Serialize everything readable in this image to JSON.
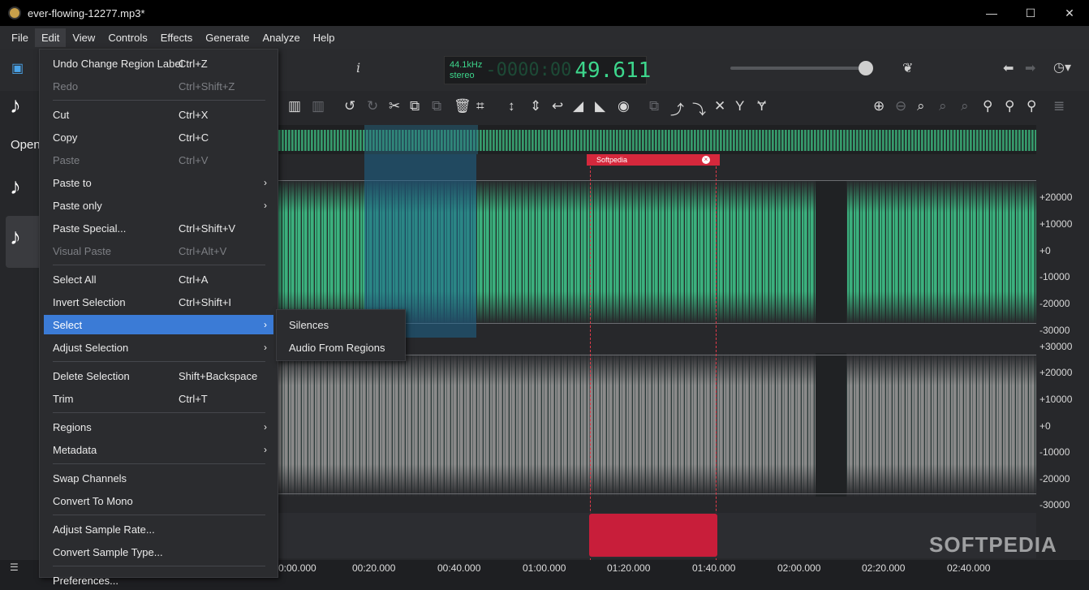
{
  "window": {
    "title": "ever-flowing-12277.mp3*",
    "controls": [
      "—",
      "☐",
      "✕"
    ]
  },
  "menubar": [
    "File",
    "Edit",
    "View",
    "Controls",
    "Effects",
    "Generate",
    "Analyze",
    "Help"
  ],
  "transport": {
    "sample_rate": "44.1kHz",
    "channels": "stereo",
    "dim_digits": "-0000:00",
    "position": "49.611"
  },
  "sidebar": {
    "open_label": "Open"
  },
  "edit_menu": {
    "items": [
      {
        "label": "Undo Change Region Label",
        "shortcut": "Ctrl+Z"
      },
      {
        "label": "Redo",
        "shortcut": "Ctrl+Shift+Z"
      },
      {
        "label": "Cut",
        "shortcut": "Ctrl+X"
      },
      {
        "label": "Copy",
        "shortcut": "Ctrl+C"
      },
      {
        "label": "Paste",
        "shortcut": "Ctrl+V"
      },
      {
        "label": "Paste to",
        "shortcut": ""
      },
      {
        "label": "Paste only",
        "shortcut": ""
      },
      {
        "label": "Paste Special...",
        "shortcut": "Ctrl+Shift+V"
      },
      {
        "label": "Visual Paste",
        "shortcut": "Ctrl+Alt+V"
      },
      {
        "label": "Select All",
        "shortcut": "Ctrl+A"
      },
      {
        "label": "Invert Selection",
        "shortcut": "Ctrl+Shift+I"
      },
      {
        "label": "Select",
        "shortcut": ""
      },
      {
        "label": "Adjust Selection",
        "shortcut": ""
      },
      {
        "label": "Delete Selection",
        "shortcut": "Shift+Backspace"
      },
      {
        "label": "Trim",
        "shortcut": "Ctrl+T"
      },
      {
        "label": "Regions",
        "shortcut": ""
      },
      {
        "label": "Metadata",
        "shortcut": ""
      },
      {
        "label": "Swap Channels",
        "shortcut": ""
      },
      {
        "label": "Convert To Mono",
        "shortcut": ""
      },
      {
        "label": "Adjust Sample Rate...",
        "shortcut": ""
      },
      {
        "label": "Convert Sample Type...",
        "shortcut": ""
      },
      {
        "label": "Preferences...",
        "shortcut": ""
      }
    ],
    "submenu_arrow": "›"
  },
  "select_submenu": [
    "Silences",
    "Audio From Regions"
  ],
  "region": {
    "label": "Softpedia",
    "close": "×"
  },
  "scale_ch1": [
    "+20000",
    "+10000",
    "+0",
    "-10000",
    "-20000",
    "-30000"
  ],
  "scale_ch2": [
    "+30000",
    "+20000",
    "+10000",
    "+0",
    "-10000",
    "-20000",
    "-30000"
  ],
  "timeline": [
    "0:00.000",
    "00:20.000",
    "00:40.000",
    "01:00.000",
    "01:20.000",
    "01:40.000",
    "02:00.000",
    "02:20.000",
    "02:40.000"
  ],
  "watermark": "SOFTPEDIA",
  "icons": {
    "app": "app-icon",
    "sidebar_toggle": "sidebar-icon",
    "info": "info-icon",
    "effects": "leaf-icon",
    "back": "arrow-left-icon",
    "forward": "arrow-right-icon",
    "history": "history-icon"
  },
  "colors": {
    "accent": "#3b7bd6",
    "wave_green": "#3cb07e",
    "region_red": "#c81e3a",
    "lcd_green": "#3dd68c"
  }
}
